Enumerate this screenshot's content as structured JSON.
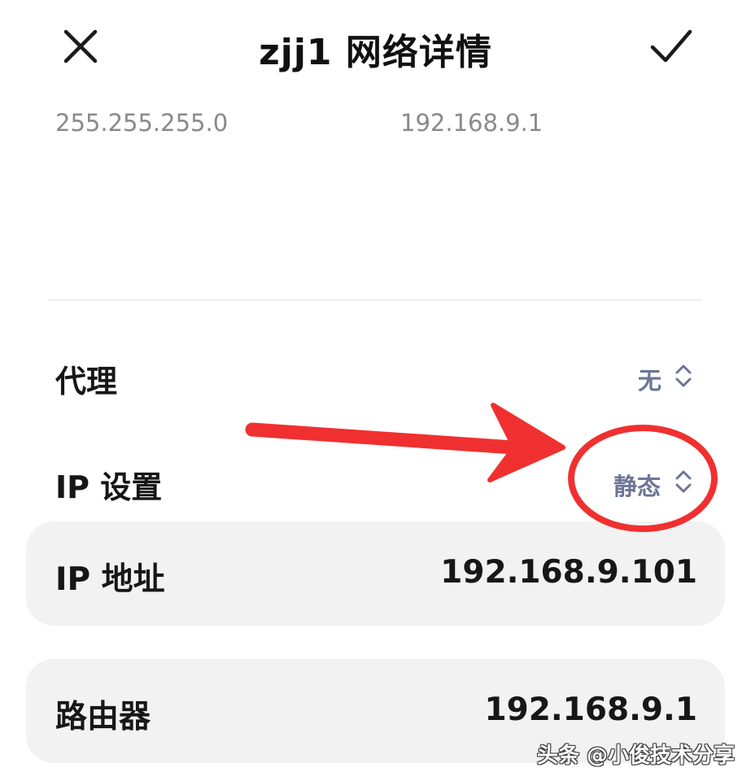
{
  "header": {
    "title": "zjj1 网络详情",
    "close_icon": "close-icon",
    "confirm_icon": "check-icon"
  },
  "network": {
    "subnet_mask": "255.255.255.0",
    "gateway": "192.168.9.1"
  },
  "settings": {
    "proxy": {
      "label": "代理",
      "value": "无"
    },
    "ip_settings": {
      "label": "IP 设置",
      "value": "静态"
    }
  },
  "fields": {
    "ip_address": {
      "label": "IP 地址",
      "value": "192.168.9.101"
    },
    "router": {
      "label": "路由器",
      "value": "192.168.9.1"
    }
  },
  "watermark": {
    "text": "头条 @小俊技术分享"
  },
  "colors": {
    "accent_value": "#6c7696",
    "annotation_red": "#f03030",
    "card_bg": "#f2f2f2"
  }
}
